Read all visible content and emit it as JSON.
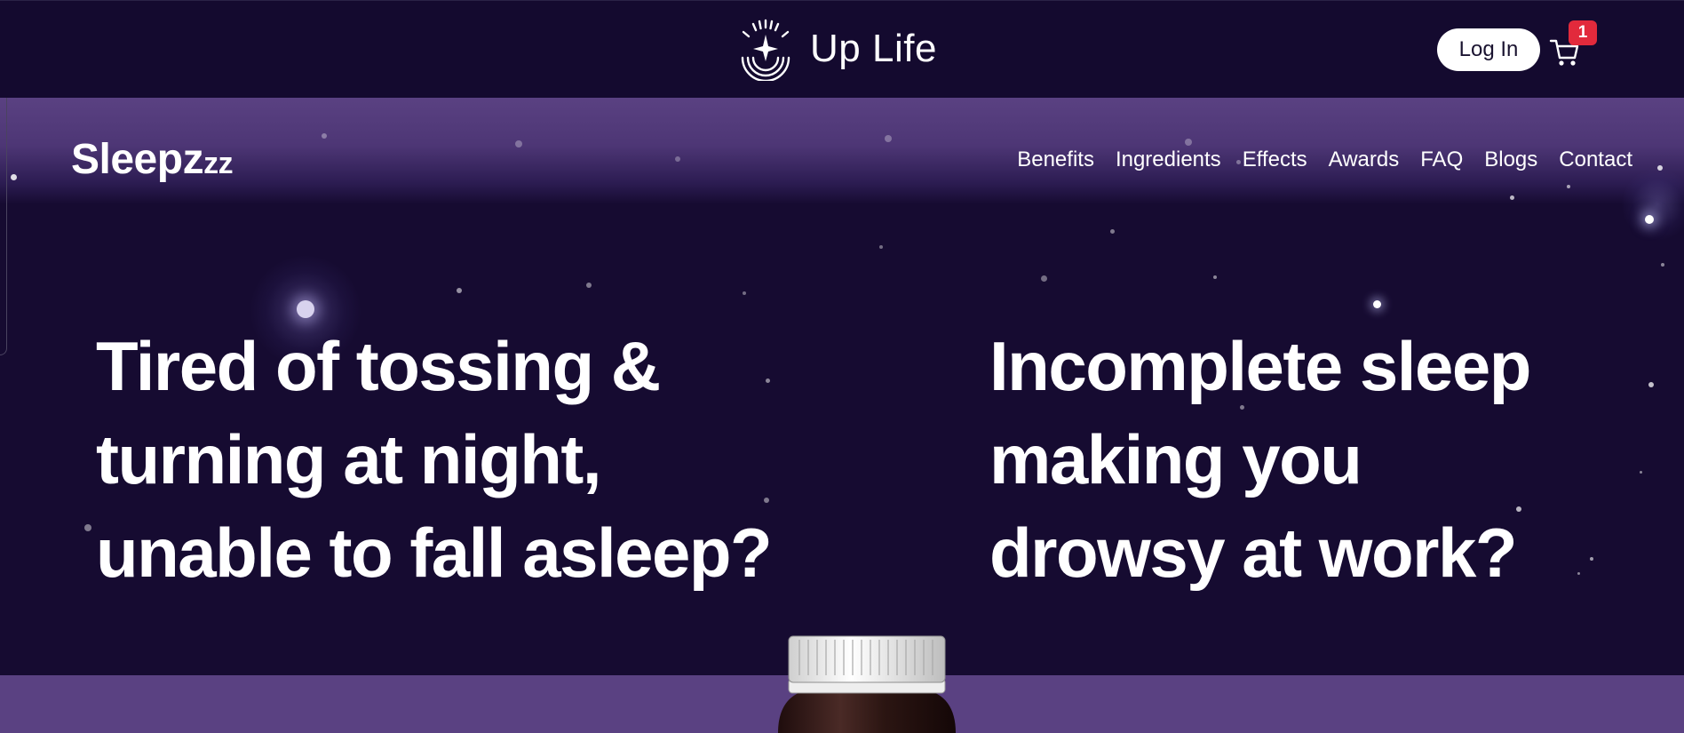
{
  "header": {
    "brand_name": "Up Life",
    "login_label": "Log In",
    "cart_count": "1",
    "logo_icon": "sunrise-star-logo",
    "cart_icon": "cart-icon"
  },
  "product": {
    "name_main": "Sleepz",
    "name_suffix": "zz"
  },
  "nav": {
    "items": [
      "Benefits",
      "Ingredients",
      "Effects",
      "Awards",
      "FAQ",
      "Blogs",
      "Contact"
    ]
  },
  "hero": {
    "left_line1": "Tired of tossing &",
    "left_line2": "turning at night,",
    "left_line3": "unable to fall asleep?",
    "right_line1": "Incomplete sleep",
    "right_line2": "making you",
    "right_line3": "drowsy at work?"
  },
  "colors": {
    "top_bar": "#140a2f",
    "hero_bg": "#160b31",
    "band_purple": "#5a4182",
    "badge_red": "#e22a3c",
    "login_bg": "#ffffff"
  }
}
